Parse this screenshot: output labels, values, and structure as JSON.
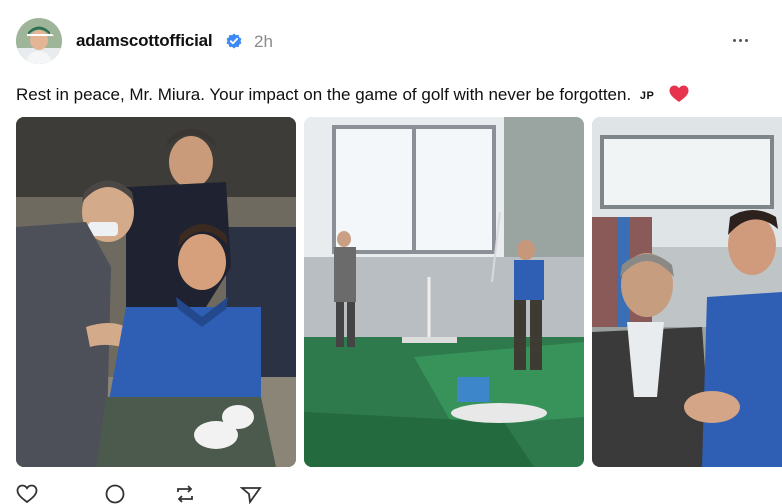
{
  "post": {
    "author": {
      "username": "adamscottofficial",
      "verified": true,
      "avatar_icon": "avatar-photo"
    },
    "time": "2h",
    "more_icon": "more-horizontal-icon",
    "caption": {
      "text": "Rest in peace, Mr. Miura. Your impact on the game of golf with never be forgotten.",
      "flag": "JP",
      "emoji_icon": "heart-icon",
      "emoji_color": "#e8334f"
    },
    "photos": [
      {
        "description_icon": "photo-golfer-with-elder"
      },
      {
        "description_icon": "photo-indoor-swing"
      },
      {
        "description_icon": "photo-handshake"
      }
    ],
    "actions": [
      "like-icon",
      "comment-icon",
      "repost-icon",
      "share-icon"
    ],
    "colors": {
      "text": "#101010",
      "secondary": "#8a8a8a",
      "verified": "#3d8af7"
    }
  }
}
